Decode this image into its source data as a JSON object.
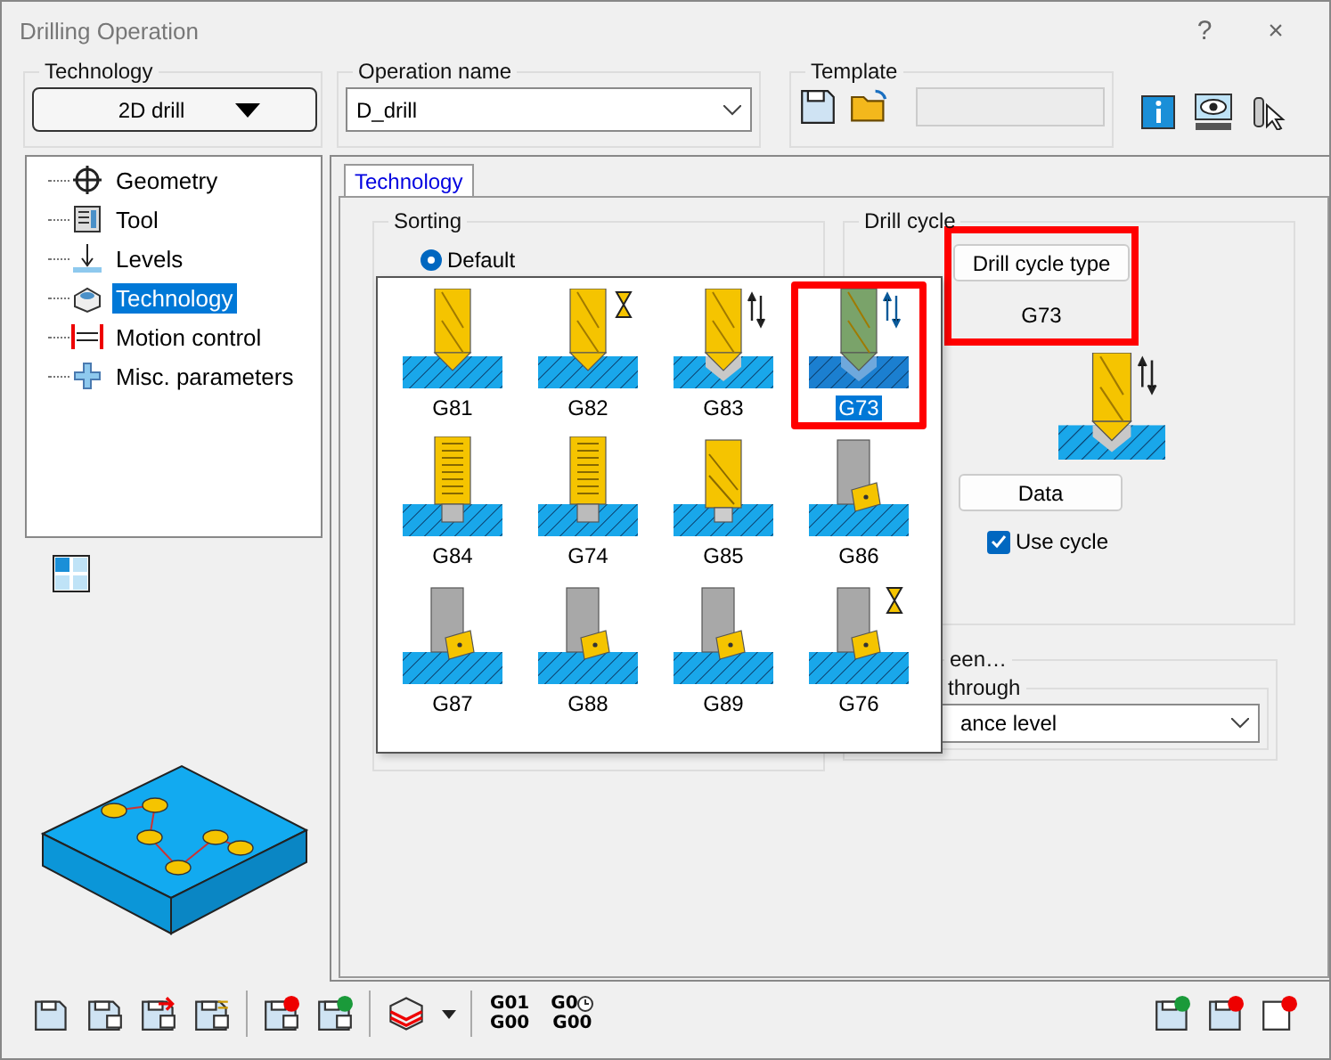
{
  "window": {
    "title": "Drilling Operation",
    "help": "?",
    "close": "×"
  },
  "technology": {
    "label": "Technology",
    "value": "2D drill"
  },
  "operation_name": {
    "label": "Operation name",
    "value": "D_drill"
  },
  "template": {
    "label": "Template"
  },
  "tree": {
    "items": [
      {
        "label": "Geometry",
        "selected": false
      },
      {
        "label": "Tool",
        "selected": false
      },
      {
        "label": "Levels",
        "selected": false
      },
      {
        "label": "Technology",
        "selected": true
      },
      {
        "label": "Motion control",
        "selected": false
      },
      {
        "label": "Misc. parameters",
        "selected": false
      }
    ]
  },
  "tabs": [
    {
      "label": "Technology",
      "selected": true
    }
  ],
  "sorting": {
    "label": "Sorting",
    "options": [
      {
        "label": "Default",
        "selected": true
      }
    ]
  },
  "cycle_picker": {
    "cells": [
      {
        "label": "G81",
        "selected": false,
        "highlighted": false
      },
      {
        "label": "G82",
        "selected": false,
        "highlighted": false
      },
      {
        "label": "G83",
        "selected": false,
        "highlighted": false
      },
      {
        "label": "G73",
        "selected": true,
        "highlighted": true
      },
      {
        "label": "G84",
        "selected": false,
        "highlighted": false
      },
      {
        "label": "G74",
        "selected": false,
        "highlighted": false
      },
      {
        "label": "G85",
        "selected": false,
        "highlighted": false
      },
      {
        "label": "G86",
        "selected": false,
        "highlighted": false
      },
      {
        "label": "G87",
        "selected": false,
        "highlighted": false
      },
      {
        "label": "G88",
        "selected": false,
        "highlighted": false
      },
      {
        "label": "G89",
        "selected": false,
        "highlighted": false
      },
      {
        "label": "G76",
        "selected": false,
        "highlighted": false
      }
    ]
  },
  "drill_cycle": {
    "label": "Drill cycle",
    "button": "Drill cycle type",
    "value": "G73",
    "highlighted": true,
    "data_button": "Data",
    "use_cycle": {
      "label": "Use cycle",
      "checked": true
    }
  },
  "lower_group": {
    "label": "een…",
    "inner_label": "through",
    "dropdown_value": "ance level"
  },
  "toolbar": {
    "gcode_buttons": [
      {
        "top": "G01",
        "bottom": "G00"
      },
      {
        "top": "G0",
        "bottom": "G00"
      }
    ]
  }
}
